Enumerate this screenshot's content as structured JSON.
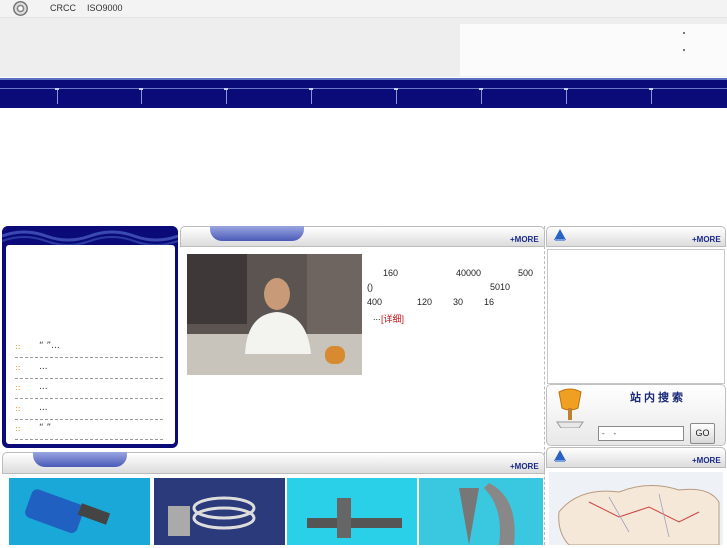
{
  "topbar": {
    "cert1": "CRCC",
    "cert2": "ISO9000"
  },
  "news_list": [
    {
      "text": "“ ”..."
    },
    {
      "text": "..."
    },
    {
      "text": "..."
    },
    {
      "text": "..."
    },
    {
      "text": "“ ”"
    }
  ],
  "intro": {
    "more": "+MORE",
    "line1": [
      "160",
      "40000",
      "500"
    ],
    "line2": [
      "()",
      "5010"
    ],
    "line3": [
      "400",
      "120",
      "30",
      "16"
    ],
    "detail_prefix": "...",
    "detail_link": "[详细]"
  },
  "right_panel": {
    "more": "+MORE"
  },
  "search": {
    "title": "站内搜索",
    "input_value": "-    -",
    "button": "GO"
  },
  "map_panel": {
    "more": "+MORE"
  },
  "products": {
    "more": "+MORE"
  },
  "colors": {
    "nav": "#0a0a78",
    "accent_link": "#c0151a",
    "more_text": "#1a2a8a"
  }
}
